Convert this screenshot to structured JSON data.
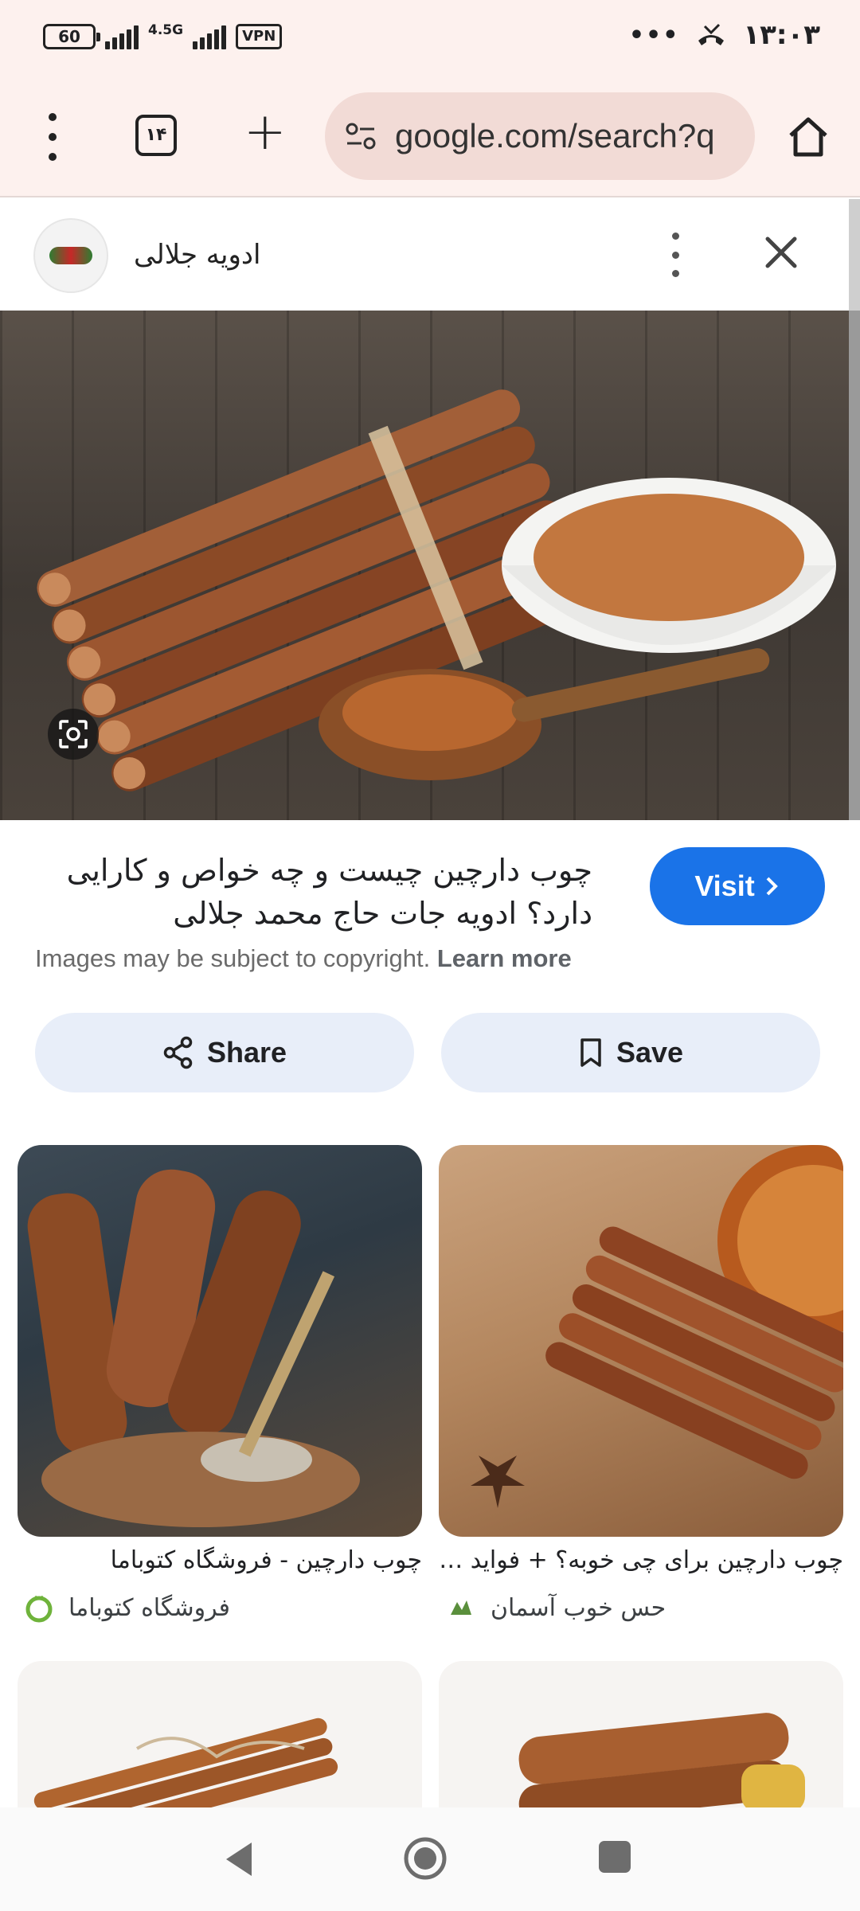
{
  "status_bar": {
    "battery": "60",
    "network": "4.5G",
    "vpn": "VPN",
    "dots": "•••",
    "time": "۱۳:۰۳"
  },
  "browser": {
    "tab_count": "۱۴",
    "url": "google.com/search?q"
  },
  "viewer": {
    "site_name": "ادویه جلالی",
    "title": "چوب دارچین چیست و چه خواص و کارایی دارد؟ ادویه جات حاج محمد جلالی",
    "visit_label": "Visit",
    "copyright_text": "Images may be subject to copyright.",
    "learn_more": "Learn more",
    "share_label": "Share",
    "save_label": "Save"
  },
  "results": [
    {
      "title": "چوب دارچین - فروشگاه کتوباما",
      "source": "فروشگاه کتوباما"
    },
    {
      "title": "چوب دارچین برای چی خوبه؟ + فواید چو...",
      "source": "حس خوب آسمان"
    }
  ],
  "colors": {
    "accent": "#1a73e8",
    "chrome_bg": "#fdf1ee",
    "omnibox_bg": "#f2dbd6",
    "pill_bg": "#e8eef9"
  }
}
